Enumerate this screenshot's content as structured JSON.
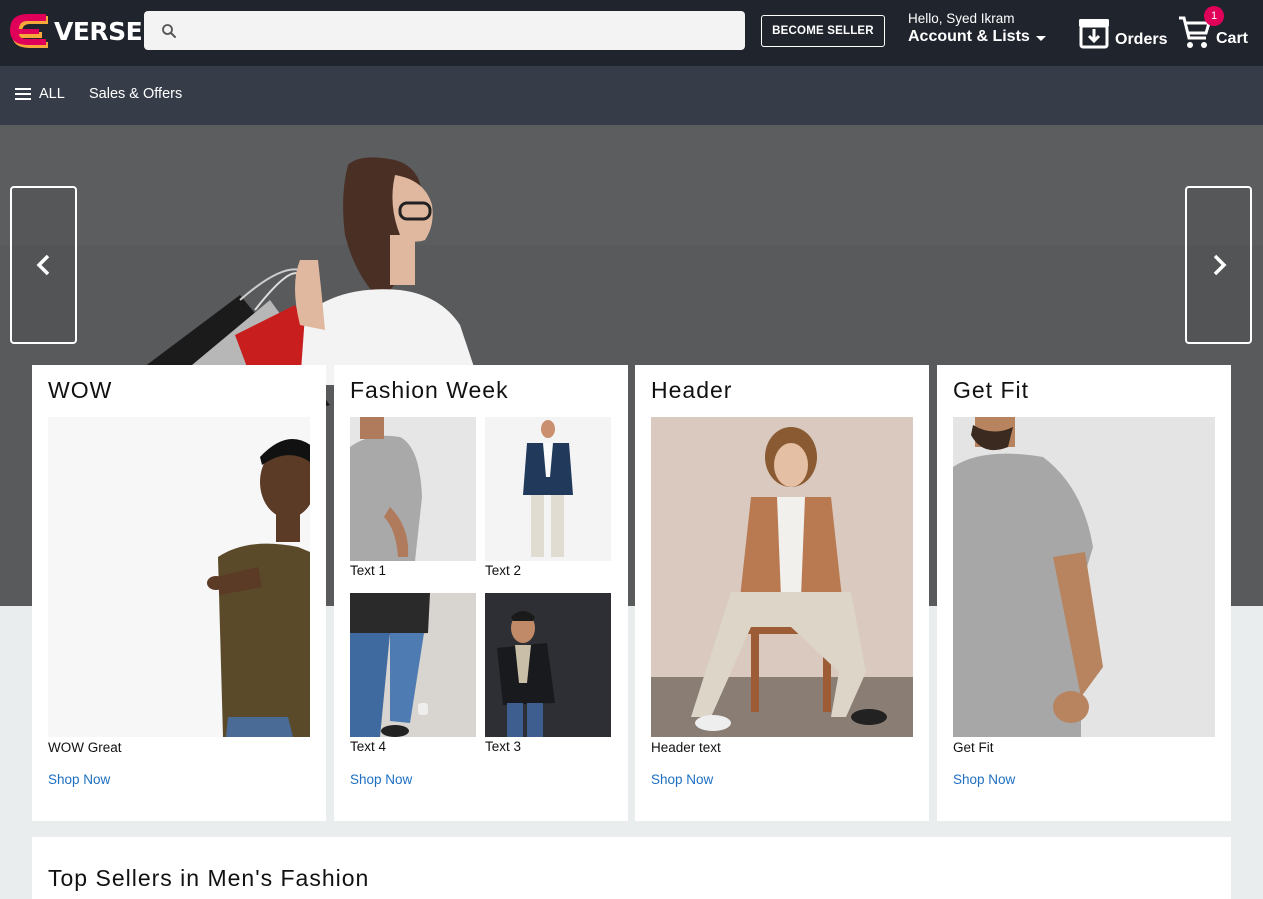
{
  "header": {
    "logo_text": "VERSE",
    "search": {
      "placeholder": "",
      "value": ""
    },
    "become_seller_label": "BECOME SELLER",
    "account": {
      "greeting": "Hello, Syed Ikram",
      "label": "Account & Lists"
    },
    "orders_label": "Orders",
    "cart": {
      "label": "Cart",
      "count": "1"
    }
  },
  "nav": {
    "all_label": "ALL",
    "items": [
      {
        "label": "Sales & Offers"
      }
    ]
  },
  "cards": [
    {
      "title": "WOW",
      "caption": "WOW Great",
      "link": "Shop Now"
    },
    {
      "title": "Fashion Week",
      "tiles": [
        {
          "label": "Text 1"
        },
        {
          "label": "Text 2"
        },
        {
          "label": "Text 4"
        },
        {
          "label": "Text 3"
        }
      ],
      "link": "Shop Now"
    },
    {
      "title": "Header",
      "caption": "Header text",
      "link": "Shop Now"
    },
    {
      "title": "Get Fit",
      "caption": "Get Fit",
      "link": "Shop Now"
    }
  ],
  "sections": {
    "top_sellers_title": "Top Sellers in Men's Fashion"
  },
  "colors": {
    "header_bg": "#20242d",
    "nav_bg": "#363c48",
    "accent_pink": "#e0005a",
    "link_blue": "#1e6fc2",
    "logo_orange": "#f7a83a"
  }
}
